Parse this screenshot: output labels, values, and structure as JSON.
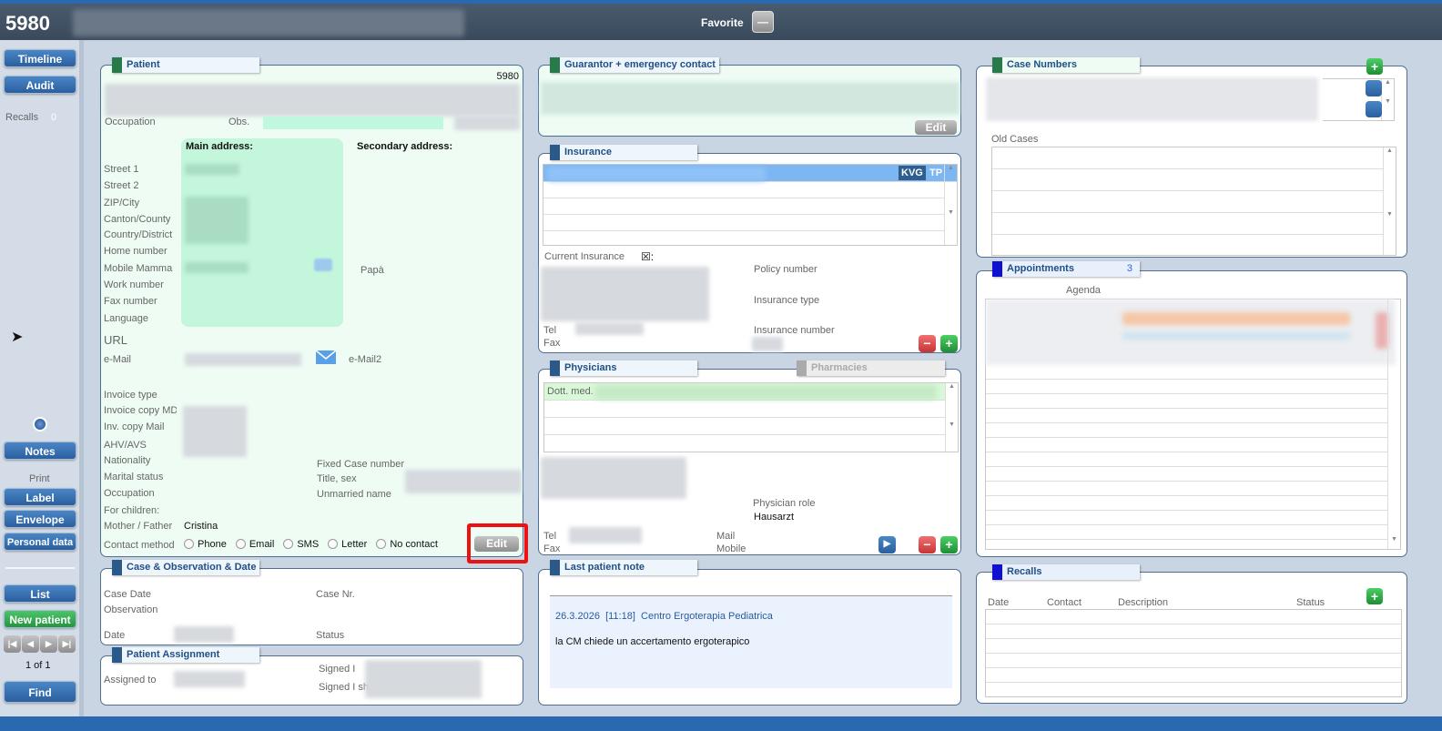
{
  "header": {
    "patient_id": "5980",
    "favorite_label": "Favorite",
    "favorite_toggle": "—"
  },
  "sidebar": {
    "timeline": "Timeline",
    "audit": "Audit",
    "recalls_label": "Recalls",
    "recalls_count": "0",
    "notes": "Notes",
    "print_label": "Print",
    "label": "Label",
    "envelope": "Envelope",
    "personal_data": "Personal data",
    "list": "List",
    "new_patient": "New patient",
    "nav": [
      "|◀",
      "◀",
      "▶",
      "▶|"
    ],
    "record_pos": "1 of 1",
    "find": "Find"
  },
  "patient": {
    "title": "Patient",
    "id": "5980",
    "occupation": "Occupation",
    "obs": "Obs.",
    "main_address": "Main address:",
    "secondary_address": "Secondary address:",
    "fields": [
      "Street 1",
      "Street 2",
      "ZIP/City",
      "Canton/County",
      "Country/District",
      "Home number",
      "Mobile Mamma",
      "Work number",
      "Fax number",
      "Language"
    ],
    "papa": "Papà",
    "url": "URL",
    "email": "e-Mail",
    "email2": "e-Mail2",
    "fields2": [
      "Invoice type",
      "Invoice copy MD",
      "Inv. copy Mail",
      "AHV/AVS",
      "Nationality",
      "Marital status",
      "Occupation",
      "For children:"
    ],
    "fixed_case": "Fixed Case number",
    "title_sex": "Title, sex",
    "unmarried": "Unmarried name",
    "mother_father": "Mother / Father",
    "mother_father_value": "Cristina",
    "contact_method": "Contact method",
    "contact_options": [
      "Phone",
      "Email",
      "SMS",
      "Letter",
      "No contact"
    ],
    "edit": "Edit"
  },
  "case_obs": {
    "title": "Case & Observation & Date",
    "case_date": "Case Date",
    "observation": "Observation",
    "date": "Date",
    "case_nr": "Case Nr.",
    "status": "Status"
  },
  "assignment": {
    "title": "Patient Assignment",
    "assigned_to": "Assigned to",
    "signed1": "Signed I",
    "signed2": "Signed I sh"
  },
  "guarantor": {
    "title": "Guarantor + emergency contact",
    "edit": "Edit"
  },
  "insurance": {
    "title": "Insurance",
    "badge1": "KVG",
    "badge2": "TP",
    "current": "Current Insurance",
    "current_mark": "☒:",
    "policy": "Policy number",
    "type": "Insurance type",
    "number": "Insurance number",
    "tel": "Tel",
    "fax": "Fax"
  },
  "physicians": {
    "title": "Physicians",
    "pharmacies": "Pharmacies",
    "row1_prefix": "Dott. med.",
    "role_label": "Physician role",
    "role": "Hausarzt",
    "tel": "Tel",
    "fax": "Fax",
    "mail": "Mail",
    "mobile": "Mobile"
  },
  "note": {
    "title": "Last patient note",
    "date": "26.3.2026",
    "time": "[11:18]",
    "org": "Centro Ergoterapia Pediatrica",
    "text": "la CM chiede un accertamento ergoterapico"
  },
  "case_numbers": {
    "title": "Case Numbers",
    "old_cases": "Old Cases"
  },
  "appointments": {
    "title": "Appointments",
    "count": "3",
    "agenda": "Agenda"
  },
  "recalls": {
    "title": "Recalls",
    "columns": [
      "Date",
      "Contact",
      "Description",
      "Status"
    ]
  },
  "colors": {
    "accent": "#2b5f9e",
    "green": "#26943f",
    "mint": "#eefcf4"
  }
}
